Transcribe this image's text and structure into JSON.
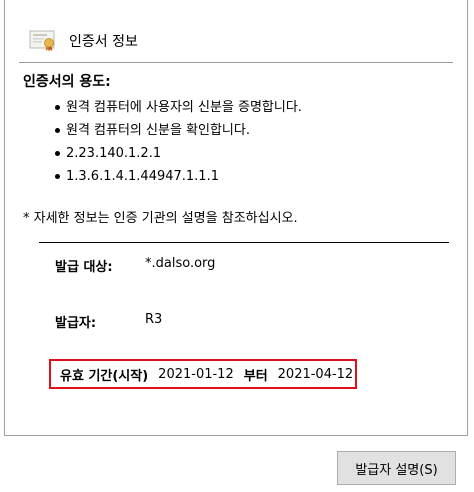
{
  "header": {
    "title": "인증서 정보",
    "icon": "certificate-icon"
  },
  "purposes": {
    "title": "인증서의 용도:",
    "items": [
      "원격 컴퓨터에 사용자의 신분을 증명합니다.",
      "원격 컴퓨터의 신분을 확인합니다.",
      "2.23.140.1.2.1",
      "1.3.6.1.4.1.44947.1.1.1"
    ]
  },
  "note": "* 자세한 정보는 인증 기관의 설명을 참조하십시오.",
  "fields": {
    "issued_to_label": "발급 대상:",
    "issued_to_value": "*.dalso.org",
    "issuer_label": "발급자:",
    "issuer_value": "R3"
  },
  "validity": {
    "label": "유효 기간(시작)",
    "from": "2021-01-12",
    "to_label": "부터",
    "to": "2021-04-12",
    "highlight_color": "#e0101a"
  },
  "buttons": {
    "issuer_statement": "발급자 설명(S)"
  }
}
